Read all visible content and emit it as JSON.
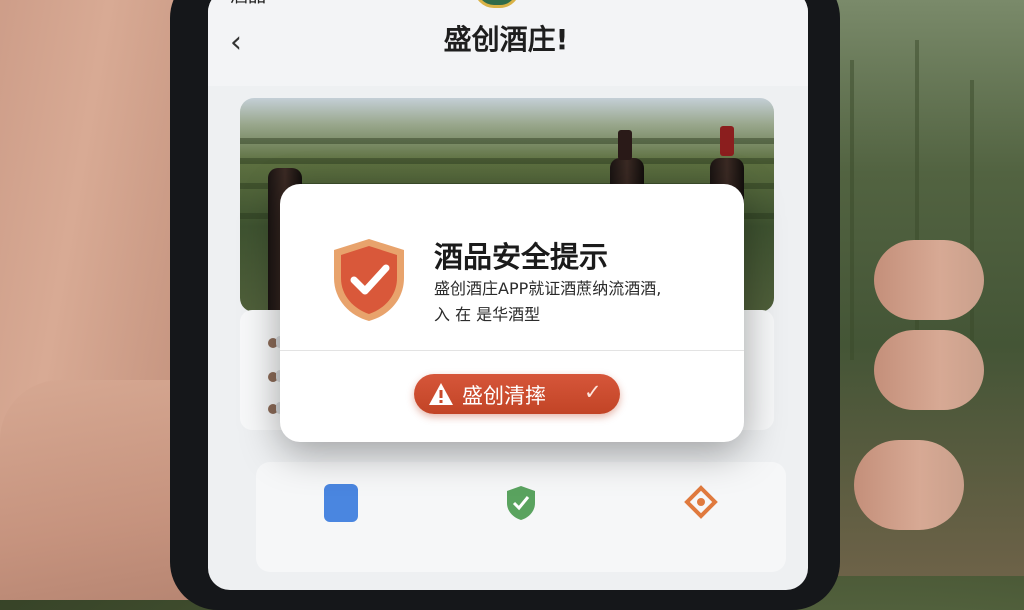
{
  "status_bar": {
    "carrier_text": "酒品",
    "icon": "signal-icon"
  },
  "header": {
    "back_icon": "back-arrow-icon",
    "back_symbol": "‹",
    "title": "盛创酒庄!"
  },
  "hero": {
    "image": "vineyard-wine-bottles-photo"
  },
  "modal": {
    "icon": "shield-check-icon",
    "title": "酒品安全提示",
    "body_line1": "盛创酒庄APP就证酒蔗纳流酒酒,",
    "body_line2": "入 在 是华酒型",
    "button": {
      "icon": "warning-triangle-icon",
      "label": "盛创清摔",
      "trailing_icon": "check-icon",
      "trailing_symbol": "✓"
    }
  },
  "bottom_nav": [
    {
      "icon": "document-icon",
      "color": "#4a86e0"
    },
    {
      "icon": "shield-icon",
      "color": "#4f9a55"
    },
    {
      "icon": "heart-box-icon",
      "color": "#e07a3e"
    }
  ],
  "colors": {
    "accent": "#c94a2c",
    "shield_fill": "#d9583a",
    "shield_border": "#e8a36c"
  }
}
